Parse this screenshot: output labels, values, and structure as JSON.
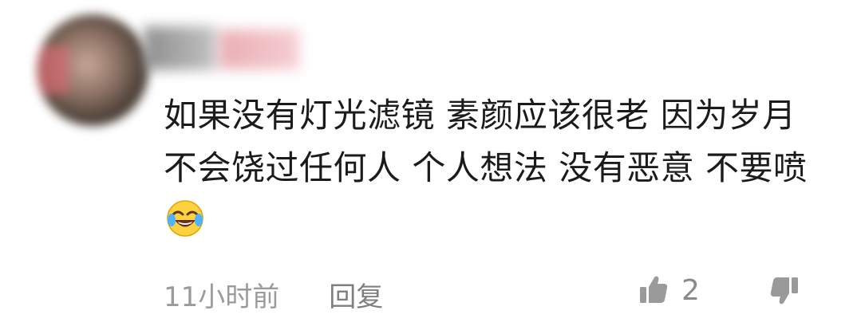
{
  "comment": {
    "text": "如果没有灯光滤镜 素颜应该很老 因为岁月不会饶过任何人 个人想法 没有恶意 不要喷",
    "emoji": "laughing-crying-emoji",
    "time": "11小时前",
    "reply_label": "回复",
    "like_count": "2"
  },
  "icons": {
    "like": "thumbs-up-icon",
    "dislike": "thumbs-down-icon"
  },
  "colors": {
    "text": "#1b1b1b",
    "meta": "#9b9b9b",
    "icon": "#9a9a9a"
  }
}
